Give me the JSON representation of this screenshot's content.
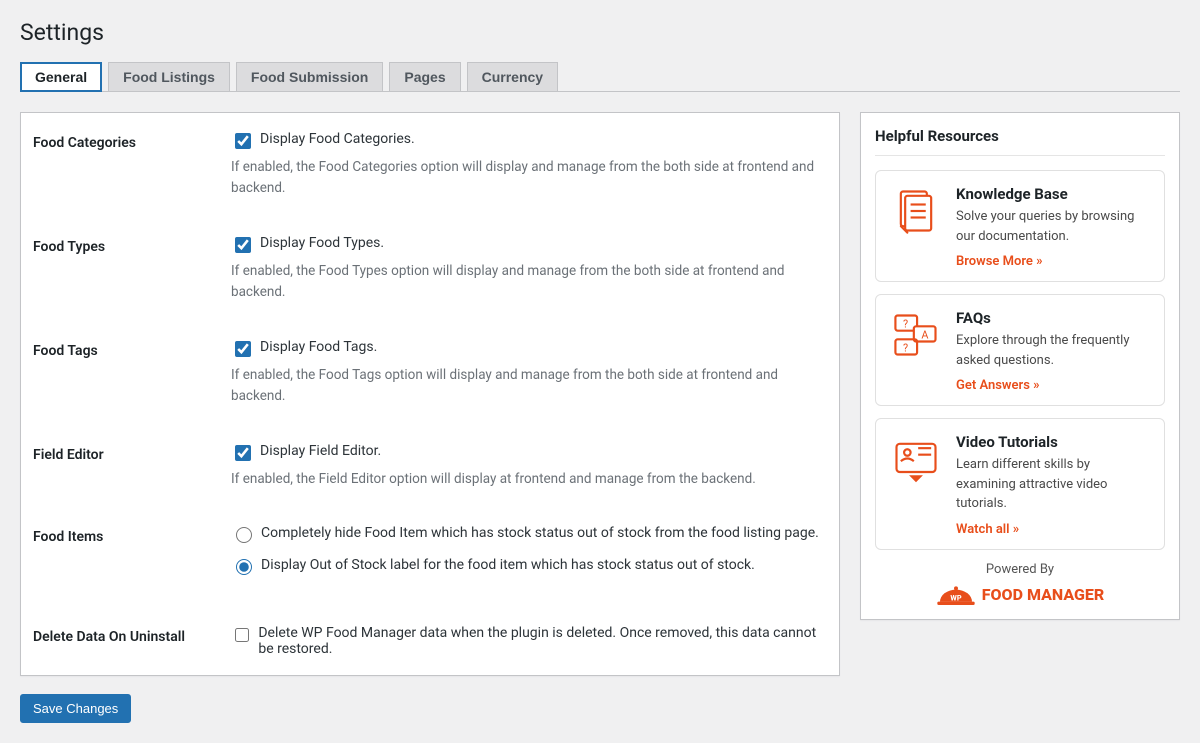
{
  "page_title": "Settings",
  "tabs": [
    {
      "label": "General",
      "active": true
    },
    {
      "label": "Food Listings",
      "active": false
    },
    {
      "label": "Food Submission",
      "active": false
    },
    {
      "label": "Pages",
      "active": false
    },
    {
      "label": "Currency",
      "active": false
    }
  ],
  "settings": {
    "food_categories": {
      "heading": "Food Categories",
      "checkbox_label": "Display Food Categories.",
      "checked": true,
      "description": "If enabled, the Food Categories option will display and manage from the both side at frontend and backend."
    },
    "food_types": {
      "heading": "Food Types",
      "checkbox_label": "Display Food Types.",
      "checked": true,
      "description": "If enabled, the Food Types option will display and manage from the both side at frontend and backend."
    },
    "food_tags": {
      "heading": "Food Tags",
      "checkbox_label": "Display Food Tags.",
      "checked": true,
      "description": "If enabled, the Food Tags option will display and manage from the both side at frontend and backend."
    },
    "field_editor": {
      "heading": "Field Editor",
      "checkbox_label": "Display Field Editor.",
      "checked": true,
      "description": "If enabled, the Field Editor option will display at frontend and manage from the backend."
    },
    "food_items": {
      "heading": "Food Items",
      "options": [
        {
          "label": "Completely hide Food Item which has stock status out of stock from the food listing page.",
          "selected": false
        },
        {
          "label": "Display Out of Stock label for the food item which has stock status out of stock.",
          "selected": true
        }
      ]
    },
    "delete_data": {
      "heading": "Delete Data On Uninstall",
      "checkbox_label": "Delete WP Food Manager data when the plugin is deleted. Once removed, this data cannot be restored.",
      "checked": false
    }
  },
  "save_button": "Save Changes",
  "sidebar": {
    "title": "Helpful Resources",
    "items": [
      {
        "title": "Knowledge Base",
        "description": "Solve your queries by browsing our documentation.",
        "link_text": "Browse More »"
      },
      {
        "title": "FAQs",
        "description": "Explore through the frequently asked questions.",
        "link_text": "Get Answers »"
      },
      {
        "title": "Video Tutorials",
        "description": "Learn different skills by examining attractive video tutorials.",
        "link_text": "Watch all »"
      }
    ],
    "powered_by": "Powered By",
    "brand": "FOOD MANAGER",
    "brand_badge": "WP"
  }
}
